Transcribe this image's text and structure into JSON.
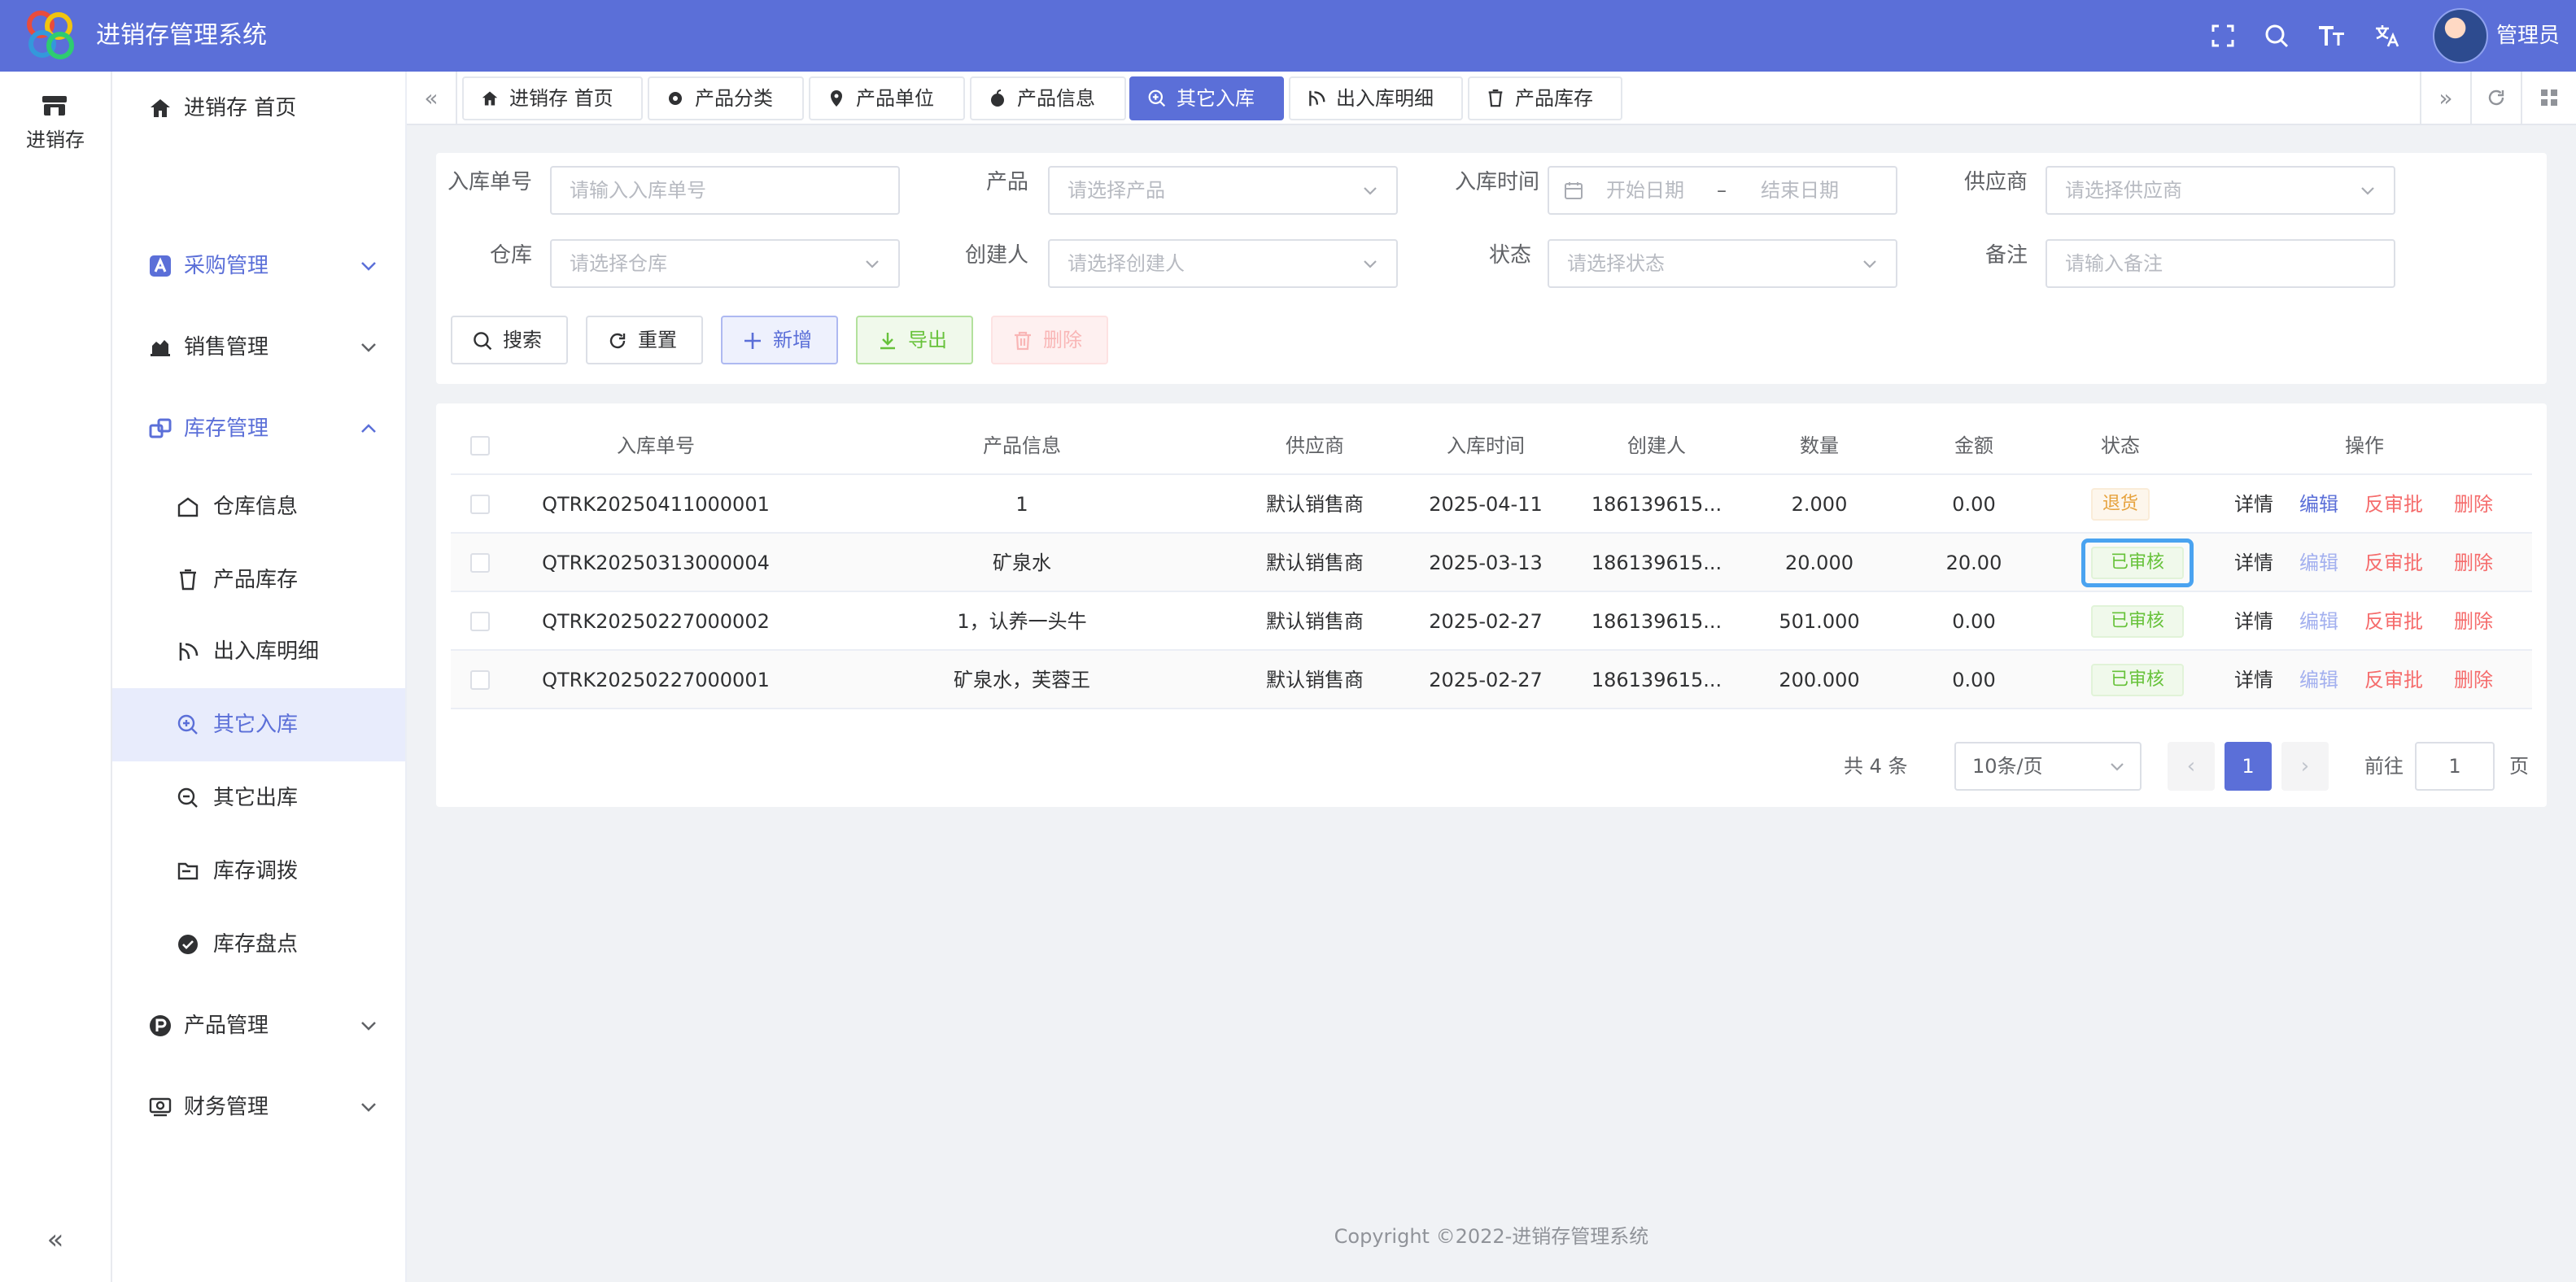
{
  "header": {
    "app_title": "进销存管理系统",
    "user_name": "管理员",
    "brand_color": "#5b6fd8",
    "icons": [
      "fullscreen-icon",
      "search-icon",
      "font-size-icon",
      "translate-icon"
    ]
  },
  "rail": {
    "item_label": "进销存",
    "collapse_glyph": "«"
  },
  "sidebar": {
    "items": [
      {
        "label": "进销存 首页",
        "icon": "home-icon"
      },
      {
        "label": "采购管理",
        "icon": "purchase-icon",
        "expandable": true
      },
      {
        "label": "销售管理",
        "icon": "sales-icon",
        "expandable": true
      },
      {
        "label": "库存管理",
        "icon": "inventory-icon",
        "expanded": true
      },
      {
        "label": "产品管理",
        "icon": "product-icon",
        "expandable": true
      },
      {
        "label": "财务管理",
        "icon": "finance-icon",
        "expandable": true
      }
    ],
    "inventory_sub": [
      {
        "label": "仓库信息",
        "icon": "warehouse-icon"
      },
      {
        "label": "产品库存",
        "icon": "cup-icon"
      },
      {
        "label": "出入库明细",
        "icon": "detail-icon"
      },
      {
        "label": "其它入库",
        "icon": "zoom-in-icon",
        "active": true
      },
      {
        "label": "其它出库",
        "icon": "zoom-out-icon"
      },
      {
        "label": "库存调拨",
        "icon": "folder-icon"
      },
      {
        "label": "库存盘点",
        "icon": "check-circle-icon"
      }
    ]
  },
  "tabs": [
    {
      "label": "进销存 首页",
      "icon": "home-icon"
    },
    {
      "label": "产品分类",
      "icon": "gear-icon"
    },
    {
      "label": "产品单位",
      "icon": "location-icon"
    },
    {
      "label": "产品信息",
      "icon": "apple-icon"
    },
    {
      "label": "其它入库",
      "icon": "zoom-in-icon",
      "active": true
    },
    {
      "label": "出入库明细",
      "icon": "detail-icon"
    },
    {
      "label": "产品库存",
      "icon": "cup-icon"
    }
  ],
  "search": {
    "order_no": {
      "label": "入库单号",
      "placeholder": "请输入入库单号"
    },
    "product": {
      "label": "产品",
      "placeholder": "请选择产品"
    },
    "date": {
      "label": "入库时间",
      "start_placeholder": "开始日期",
      "separator": "–",
      "end_placeholder": "结束日期"
    },
    "supplier": {
      "label": "供应商",
      "placeholder": "请选择供应商"
    },
    "warehouse": {
      "label": "仓库",
      "placeholder": "请选择仓库"
    },
    "creator": {
      "label": "创建人",
      "placeholder": "请选择创建人"
    },
    "status": {
      "label": "状态",
      "placeholder": "请选择状态"
    },
    "remark": {
      "label": "备注",
      "placeholder": "请输入备注"
    },
    "buttons": {
      "search": "搜索",
      "reset": "重置",
      "add": "新增",
      "export": "导出",
      "delete": "删除"
    }
  },
  "table": {
    "columns": [
      "入库单号",
      "产品信息",
      "供应商",
      "入库时间",
      "创建人",
      "数量",
      "金额",
      "状态",
      "操作"
    ],
    "rows": [
      {
        "order_no": "QTRK20250411000001",
        "product": "1",
        "supplier": "默认销售商",
        "date": "2025-04-11",
        "creator": "186139615...",
        "qty": "2.000",
        "amount": "0.00",
        "status": "退货",
        "status_type": "returned",
        "edit_enabled": true
      },
      {
        "order_no": "QTRK20250313000004",
        "product": "矿泉水",
        "supplier": "默认销售商",
        "date": "2025-03-13",
        "creator": "186139615...",
        "qty": "20.000",
        "amount": "20.00",
        "status": "已审核",
        "status_type": "approved",
        "edit_enabled": false
      },
      {
        "order_no": "QTRK20250227000002",
        "product": "1，认养一头牛",
        "supplier": "默认销售商",
        "date": "2025-02-27",
        "creator": "186139615...",
        "qty": "501.000",
        "amount": "0.00",
        "status": "已审核",
        "status_type": "approved",
        "edit_enabled": false
      },
      {
        "order_no": "QTRK20250227000001",
        "product": "矿泉水，芙蓉王",
        "supplier": "默认销售商",
        "date": "2025-02-27",
        "creator": "186139615...",
        "qty": "200.000",
        "amount": "0.00",
        "status": "已审核",
        "status_type": "approved",
        "edit_enabled": false
      }
    ],
    "actions": {
      "detail": "详情",
      "edit": "编辑",
      "unapprove": "反审批",
      "delete": "删除"
    }
  },
  "pagination": {
    "total_text": "共 4 条",
    "page_size": "10条/页",
    "current_page": "1",
    "goto_label": "前往",
    "goto_value": "1",
    "goto_suffix": "页"
  },
  "footer": {
    "copyright": "Copyright ©2022-进销存管理系统"
  }
}
